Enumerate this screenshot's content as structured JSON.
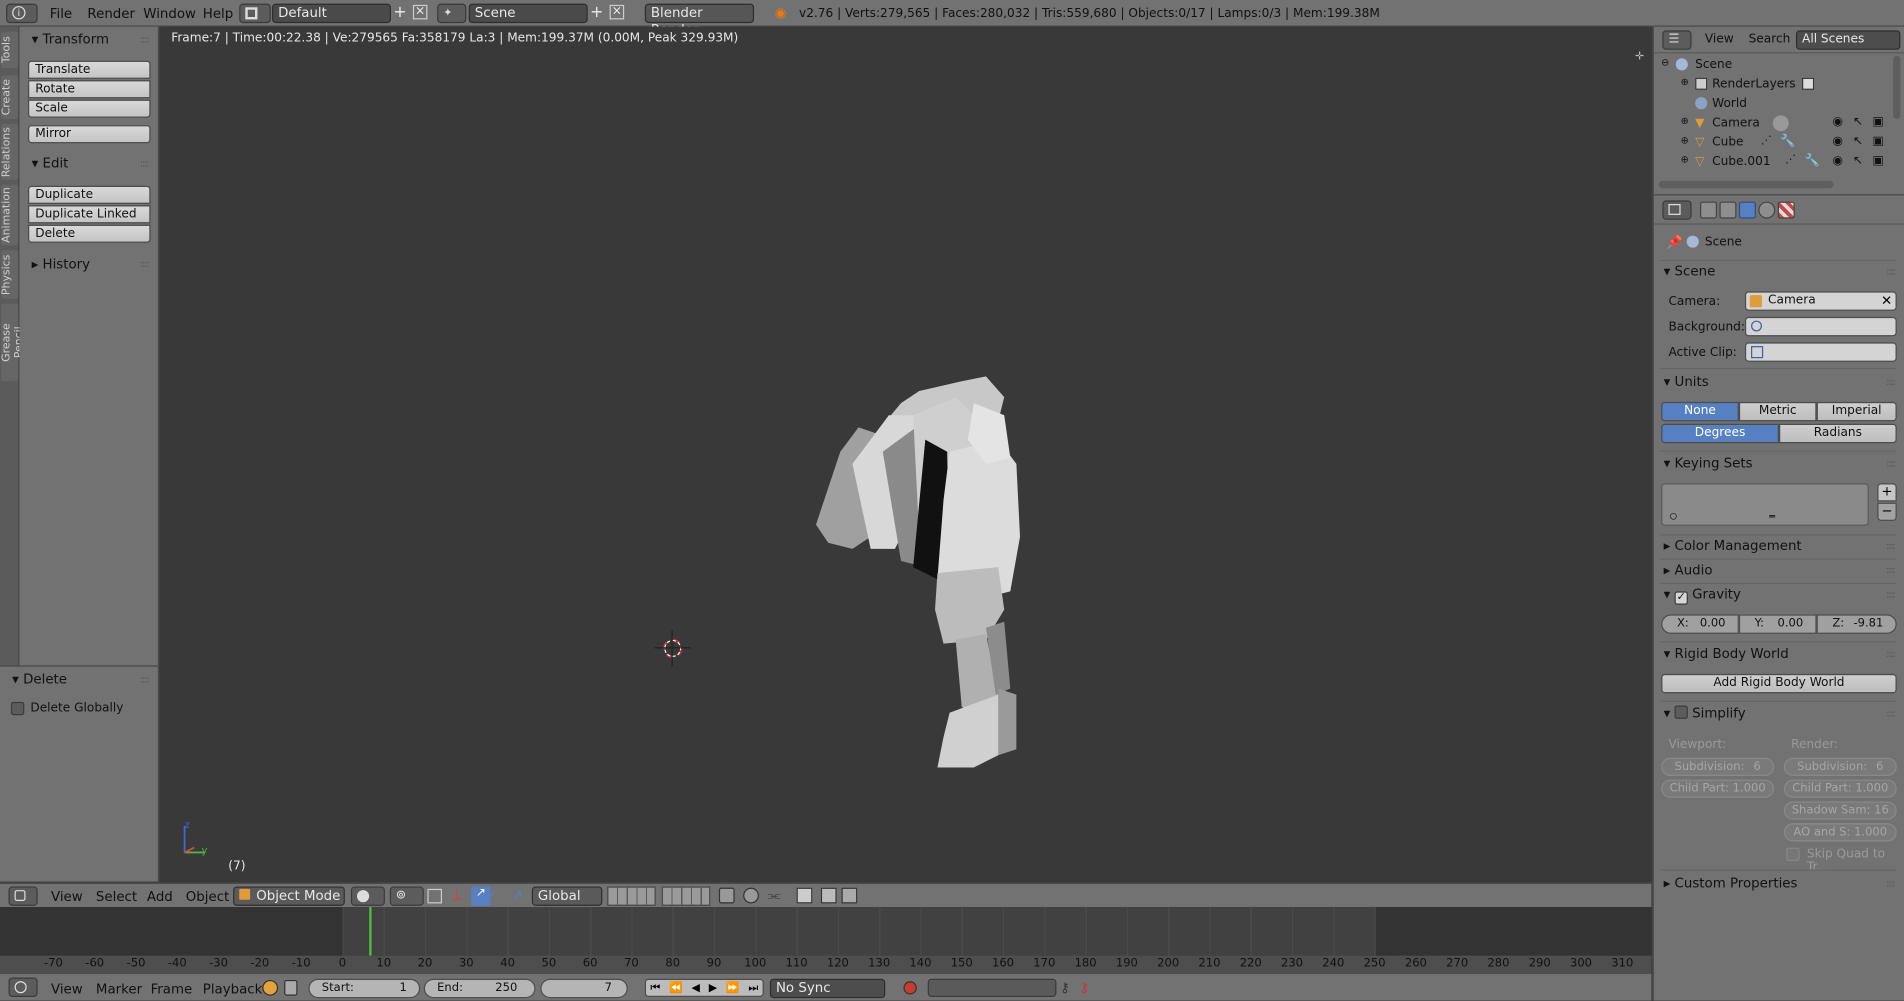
{
  "topbar": {
    "menus": [
      "File",
      "Render",
      "Window",
      "Help"
    ],
    "layout": "Default",
    "scene": "Scene",
    "engine": "Blender Render",
    "stats": "v2.76 | Verts:279,565 | Faces:280,032 | Tris:559,680 | Objects:0/17 | Lamps:0/3 | Mem:199.38M"
  },
  "tabs": [
    "Tools",
    "Create",
    "Relations",
    "Animation",
    "Physics",
    "Grease Pencil"
  ],
  "tools": {
    "transform": "Transform",
    "translate": "Translate",
    "rotate": "Rotate",
    "scale": "Scale",
    "mirror": "Mirror",
    "edit": "Edit",
    "duplicate": "Duplicate",
    "duplicate_linked": "Duplicate Linked",
    "delete": "Delete",
    "history": "History"
  },
  "operator": {
    "title": "Delete",
    "option": "Delete Globally"
  },
  "viewport": {
    "info": "Frame:7 | Time:00:22.38 | Ve:279565 Fa:358179 La:3 | Mem:199.37M (0.00M, Peak 329.93M)",
    "frame_label": "(7)",
    "axis_z": "z",
    "axis_y": "y"
  },
  "hdr3d": {
    "menus": [
      "View",
      "Select",
      "Add",
      "Object"
    ],
    "mode": "Object Mode",
    "orientation": "Global"
  },
  "timeline": {
    "ticks": [
      "-70",
      "-60",
      "-50",
      "-40",
      "-30",
      "-20",
      "-10",
      "0",
      "10",
      "20",
      "30",
      "40",
      "50",
      "60",
      "70",
      "80",
      "90",
      "100",
      "110",
      "120",
      "130",
      "140",
      "150",
      "160",
      "170",
      "180",
      "190",
      "200",
      "210",
      "220",
      "230",
      "240",
      "250",
      "260",
      "270",
      "280",
      "290",
      "300",
      "310"
    ],
    "current": 7
  },
  "tlbar": {
    "menus": [
      "View",
      "Marker",
      "Frame",
      "Playback"
    ],
    "start_label": "Start:",
    "start": "1",
    "end_label": "End:",
    "end": "250",
    "current": "7",
    "sync": "No Sync"
  },
  "outliner": {
    "view": "View",
    "search": "Search",
    "filter": "All Scenes",
    "items": [
      "Scene",
      "RenderLayers",
      "World",
      "Camera",
      "Cube",
      "Cube.001"
    ]
  },
  "props": {
    "breadcrumb": "Scene",
    "scene_section": "Scene",
    "camera_label": "Camera:",
    "camera_value": "Camera",
    "background_label": "Background:",
    "active_clip_label": "Active Clip:",
    "units": "Units",
    "unit_none": "None",
    "unit_metric": "Metric",
    "unit_imperial": "Imperial",
    "degrees": "Degrees",
    "radians": "Radians",
    "keying_sets": "Keying Sets",
    "color_management": "Color Management",
    "audio": "Audio",
    "gravity": "Gravity",
    "gx_label": "X:",
    "gx": "0.00",
    "gy_label": "Y:",
    "gy": "0.00",
    "gz_label": "Z:",
    "gz": "-9.81",
    "rigid_body": "Rigid Body World",
    "add_rigid": "Add Rigid Body World",
    "simplify": "Simplify",
    "viewport_label": "Viewport:",
    "render_label": "Render:",
    "subdiv_label": "Subdivision:",
    "subdiv_v": "6",
    "subdiv_r": "6",
    "child_v": "Child Part: 1.000",
    "child_r": "Child Part: 1.000",
    "shadow": "Shadow Sam: 16",
    "ao": "AO and S:  1.000",
    "skip_quad": "Skip Quad to Tr...",
    "custom": "Custom Properties"
  }
}
